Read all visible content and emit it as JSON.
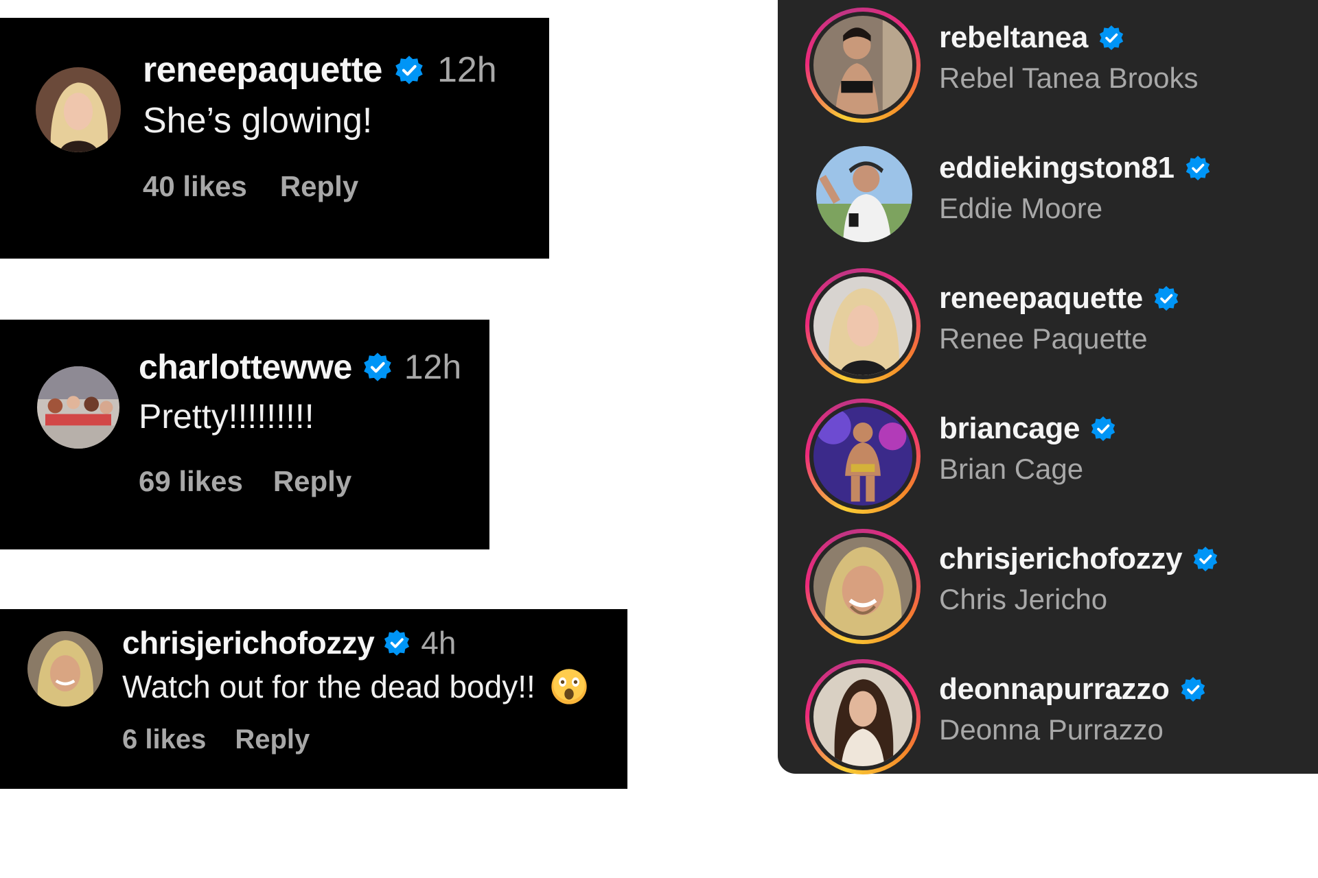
{
  "colors": {
    "card_bg": "#000000",
    "panel_bg": "#262626",
    "verified_blue": "#0095f6",
    "muted_text": "#a8a8a8",
    "page_bg": "#ffffff"
  },
  "comments": [
    {
      "username": "reneepaquette",
      "verified": true,
      "time": "12h",
      "text": "She’s glowing!",
      "likes": "40 likes",
      "reply_label": "Reply",
      "avatar_icon": "profile-photo-icon"
    },
    {
      "username": "charlottewwe",
      "verified": true,
      "time": "12h",
      "text": "Pretty!!!!!!!!!",
      "likes": "69 likes",
      "reply_label": "Reply",
      "avatar_icon": "profile-photo-icon"
    },
    {
      "username": "chrisjerichofozzy",
      "verified": true,
      "time": "4h",
      "text": "Watch out for the dead body!!",
      "emoji": "astonished-face-emoji",
      "likes": "6 likes",
      "reply_label": "Reply",
      "avatar_icon": "profile-photo-icon"
    }
  ],
  "accounts": [
    {
      "username": "rebeltanea",
      "full_name": "Rebel Tanea Brooks",
      "verified": true,
      "story_ring": true
    },
    {
      "username": "eddiekingston81",
      "full_name": "Eddie Moore",
      "verified": true,
      "story_ring": false
    },
    {
      "username": "reneepaquette",
      "full_name": "Renee Paquette",
      "verified": true,
      "story_ring": true
    },
    {
      "username": "briancage",
      "full_name": "Brian Cage",
      "verified": true,
      "story_ring": true
    },
    {
      "username": "chrisjerichofozzy",
      "full_name": "Chris Jericho",
      "verified": true,
      "story_ring": true
    },
    {
      "username": "deonnapurrazzo",
      "full_name": "Deonna Purrazzo",
      "verified": true,
      "story_ring": true
    }
  ]
}
